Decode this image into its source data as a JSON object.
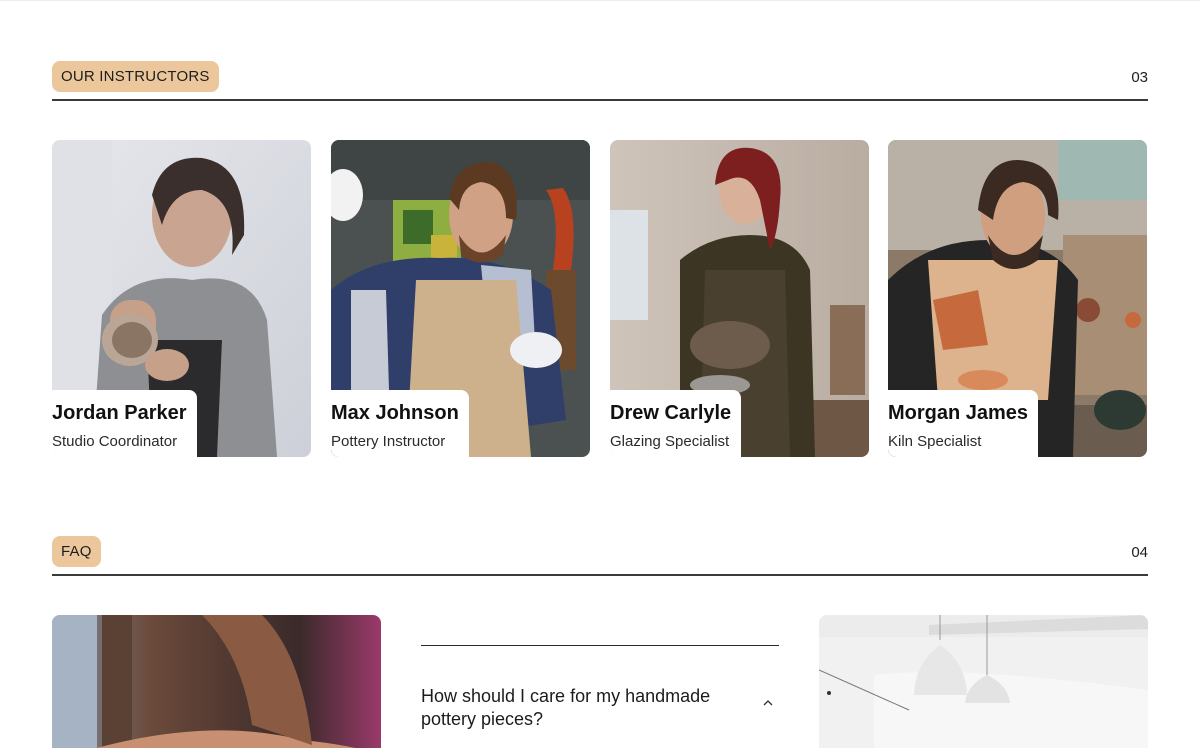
{
  "instructors_section": {
    "tag": "OUR INSTRUCTORS",
    "number": "03"
  },
  "instructors": [
    {
      "name": "Jordan Parker",
      "role": "Studio Coordinator",
      "photo_icon": "person-photo"
    },
    {
      "name": "Max Johnson",
      "role": "Pottery Instructor",
      "photo_icon": "person-photo"
    },
    {
      "name": "Drew Carlyle",
      "role": "Glazing Specialist",
      "photo_icon": "person-photo"
    },
    {
      "name": "Morgan James",
      "role": "Kiln Specialist",
      "photo_icon": "person-photo"
    }
  ],
  "faq_section": {
    "tag": "FAQ",
    "number": "04"
  },
  "faq": {
    "items": [
      {
        "question": "How should I care for my handmade pottery pieces?",
        "expanded": true
      }
    ]
  },
  "colors": {
    "tag_background": "#ecc79c",
    "rule": "#3a3a3a",
    "text": "#1c1c1c"
  }
}
